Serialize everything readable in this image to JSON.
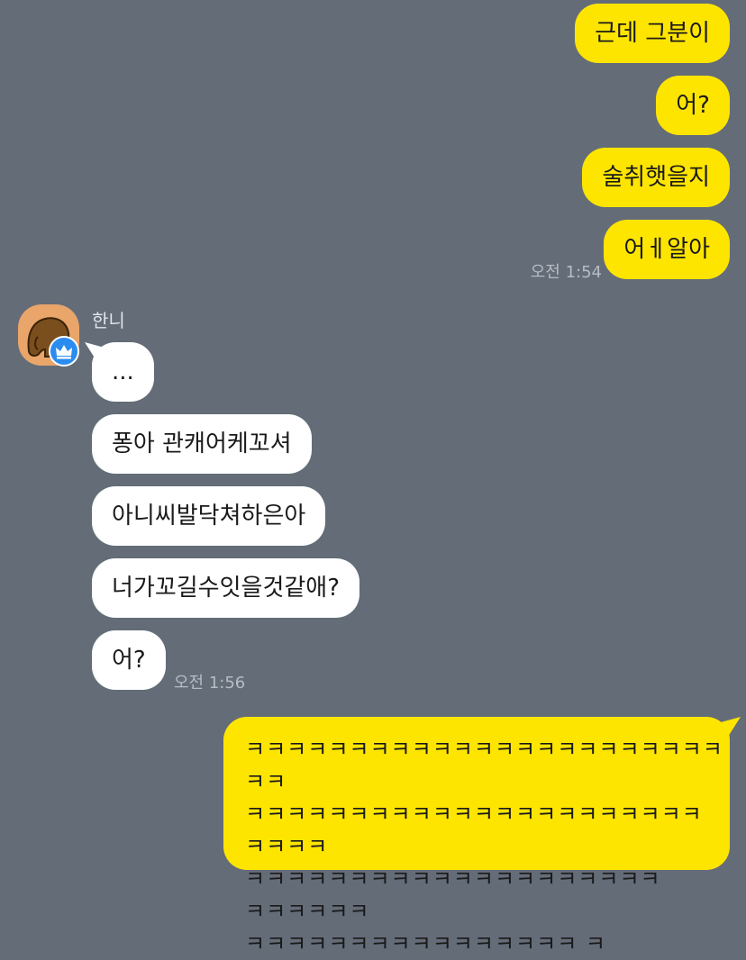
{
  "outgoing_top": [
    {
      "text": "근데 그분이"
    },
    {
      "text": "어?"
    },
    {
      "text": "술취햇을지"
    },
    {
      "text": "어ㅔ알아"
    }
  ],
  "outgoing_time": "오전 1:54",
  "sender": {
    "name": "한니",
    "avatar_icon": "elephant-avatar-icon",
    "badge_icon": "crown-badge-icon"
  },
  "incoming": [
    {
      "text": "..."
    },
    {
      "text": "퐁아 관캐어케꼬셔"
    },
    {
      "text": "아니씨발닥쳐하은아"
    },
    {
      "text": "너가꼬길수잇을것같애?"
    },
    {
      "text": "어?"
    }
  ],
  "incoming_time": "오전 1:56",
  "outgoing_long": "ㅋㅋㅋㅋㅋㅋㅋㅋㅋㅋㅋㅋㅋㅋㅋㅋㅋㅋㅋㅋㅋㅋㅋ ㅋㅋ ㅋㅋㅋㅋㅋㅋㅋㅋㅋㅋㅋㅋㅋㅋㅋㅋㅋㅋㅋㅋㅋㅋ ㅋㅋㅋㅋ ㅋㅋㅋㅋㅋㅋㅋㅋㅋㅋㅋㅋㅋㅋㅋㅋㅋㅋㅋㅋ ㅋㅋㅋㅋㅋㅋ ㅋㅋㅋㅋㅋㅋㅋㅋㅋㅋㅋㅋㅋㅋㅋㅋ ㅋ",
  "colors": {
    "background": "#646c78",
    "my_bubble": "#fee500",
    "their_bubble": "#ffffff",
    "badge": "#2b8cf0"
  }
}
